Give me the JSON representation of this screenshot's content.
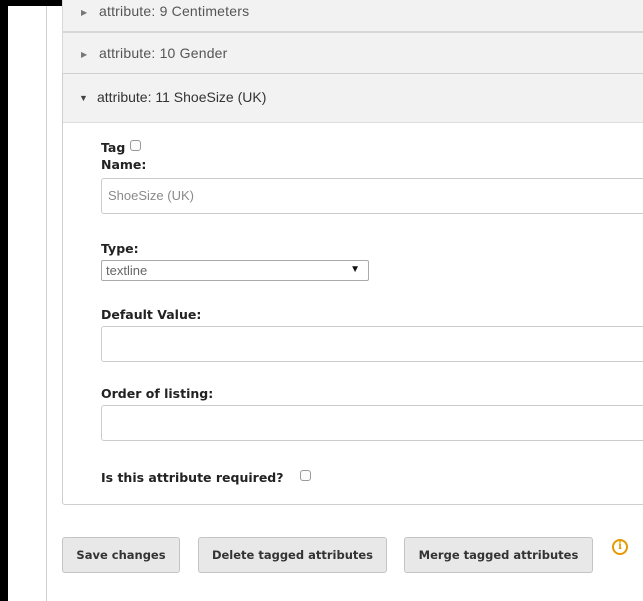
{
  "accordion": {
    "collapsed_items": [
      {
        "label": "attribute: 9 Centimeters"
      },
      {
        "label": "attribute: 10 Gender"
      }
    ],
    "expanded_item": {
      "label": "attribute: 11 ShoeSize (UK)",
      "fields": {
        "tag_label": "Tag",
        "name_label": "Name:",
        "name_value": "ShoeSize (UK)",
        "type_label": "Type:",
        "type_value": "textline",
        "default_value_label": "Default Value:",
        "default_value": "",
        "order_label": "Order of listing:",
        "order_value": "",
        "required_label": "Is this attribute required?"
      }
    }
  },
  "actions": {
    "save_label": "Save changes",
    "delete_label": "Delete tagged attributes",
    "merge_label": "Merge tagged attributes",
    "info_icon": "info-icon"
  },
  "colors": {
    "info_accent": "#e39a00",
    "row_background": "#f2f2f2"
  }
}
